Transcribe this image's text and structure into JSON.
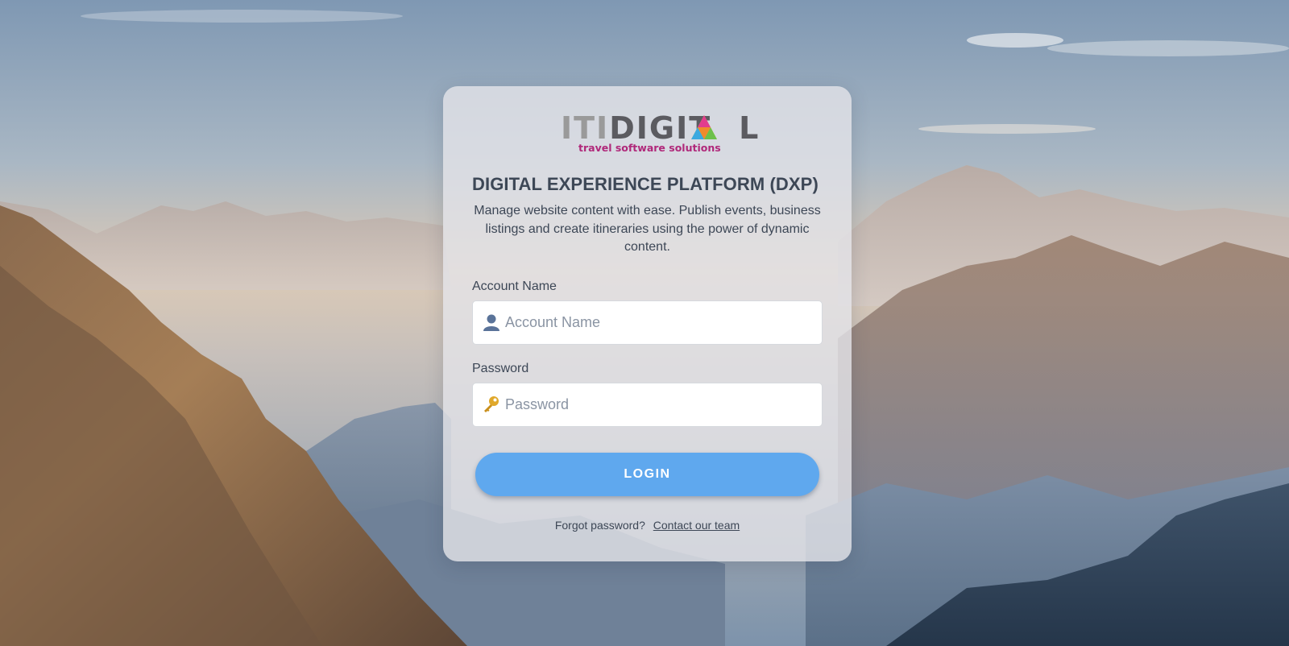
{
  "brand": {
    "logo_prefix": "ITI",
    "logo_word_start": "DIGIT",
    "logo_word_end": "L",
    "tagline": "travel software solutions"
  },
  "header": {
    "title": "DIGITAL EXPERIENCE PLATFORM (DXP)",
    "description": "Manage website content with ease. Publish events, business listings and create itineraries using the power of dynamic content."
  },
  "form": {
    "account": {
      "label": "Account Name",
      "placeholder": "Account Name",
      "value": "",
      "icon": "user-icon"
    },
    "password": {
      "label": "Password",
      "placeholder": "Password",
      "value": "",
      "icon": "key-icon"
    },
    "login_label": "LOGIN"
  },
  "footer": {
    "forgot_text": "Forgot password?",
    "contact_link": "Contact our team"
  },
  "colors": {
    "button": "#5fa8ee",
    "text": "#3d4756",
    "tagline": "#b0287a"
  }
}
